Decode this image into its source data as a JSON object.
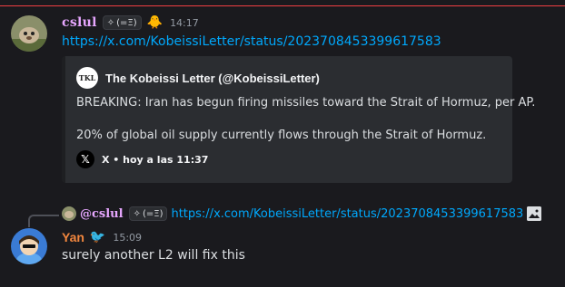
{
  "message1": {
    "username": "cslul",
    "tag": "(=Ξ)",
    "tag_icon": "sparkle-icon",
    "badge_emoji": "🐥",
    "time": "14:17",
    "link": "https://x.com/KobeissiLetter/status/2023708453399617583",
    "embed": {
      "logo_text": "TKL",
      "author": "The Kobeissi Letter (@KobeissiLetter)",
      "text_p1": "BREAKING: Iran has begun firing missiles toward the Strait of Hormuz, per AP.",
      "text_p2": "20% of global oil supply currently flows through the Strait of Hormuz.",
      "footer_icon": "x-logo-icon",
      "footer_text": "X • hoy a las 11:37"
    }
  },
  "reply_ref": {
    "username": "@cslul",
    "tag": "(=Ξ)",
    "link": "https://x.com/KobeissiLetter/status/2023708453399617583",
    "attachment_icon": "image-icon"
  },
  "message2": {
    "username": "Yan",
    "badge_emoji": "🐦",
    "time": "15:09",
    "text": "surely another L2 will fix this"
  },
  "colors": {
    "background": "#1a1a1e",
    "embed_bg": "#2b2d31",
    "link": "#00a8fc",
    "user1": "#e7a7ff",
    "user2": "#f1863e",
    "top_divider": "#f23f43"
  }
}
